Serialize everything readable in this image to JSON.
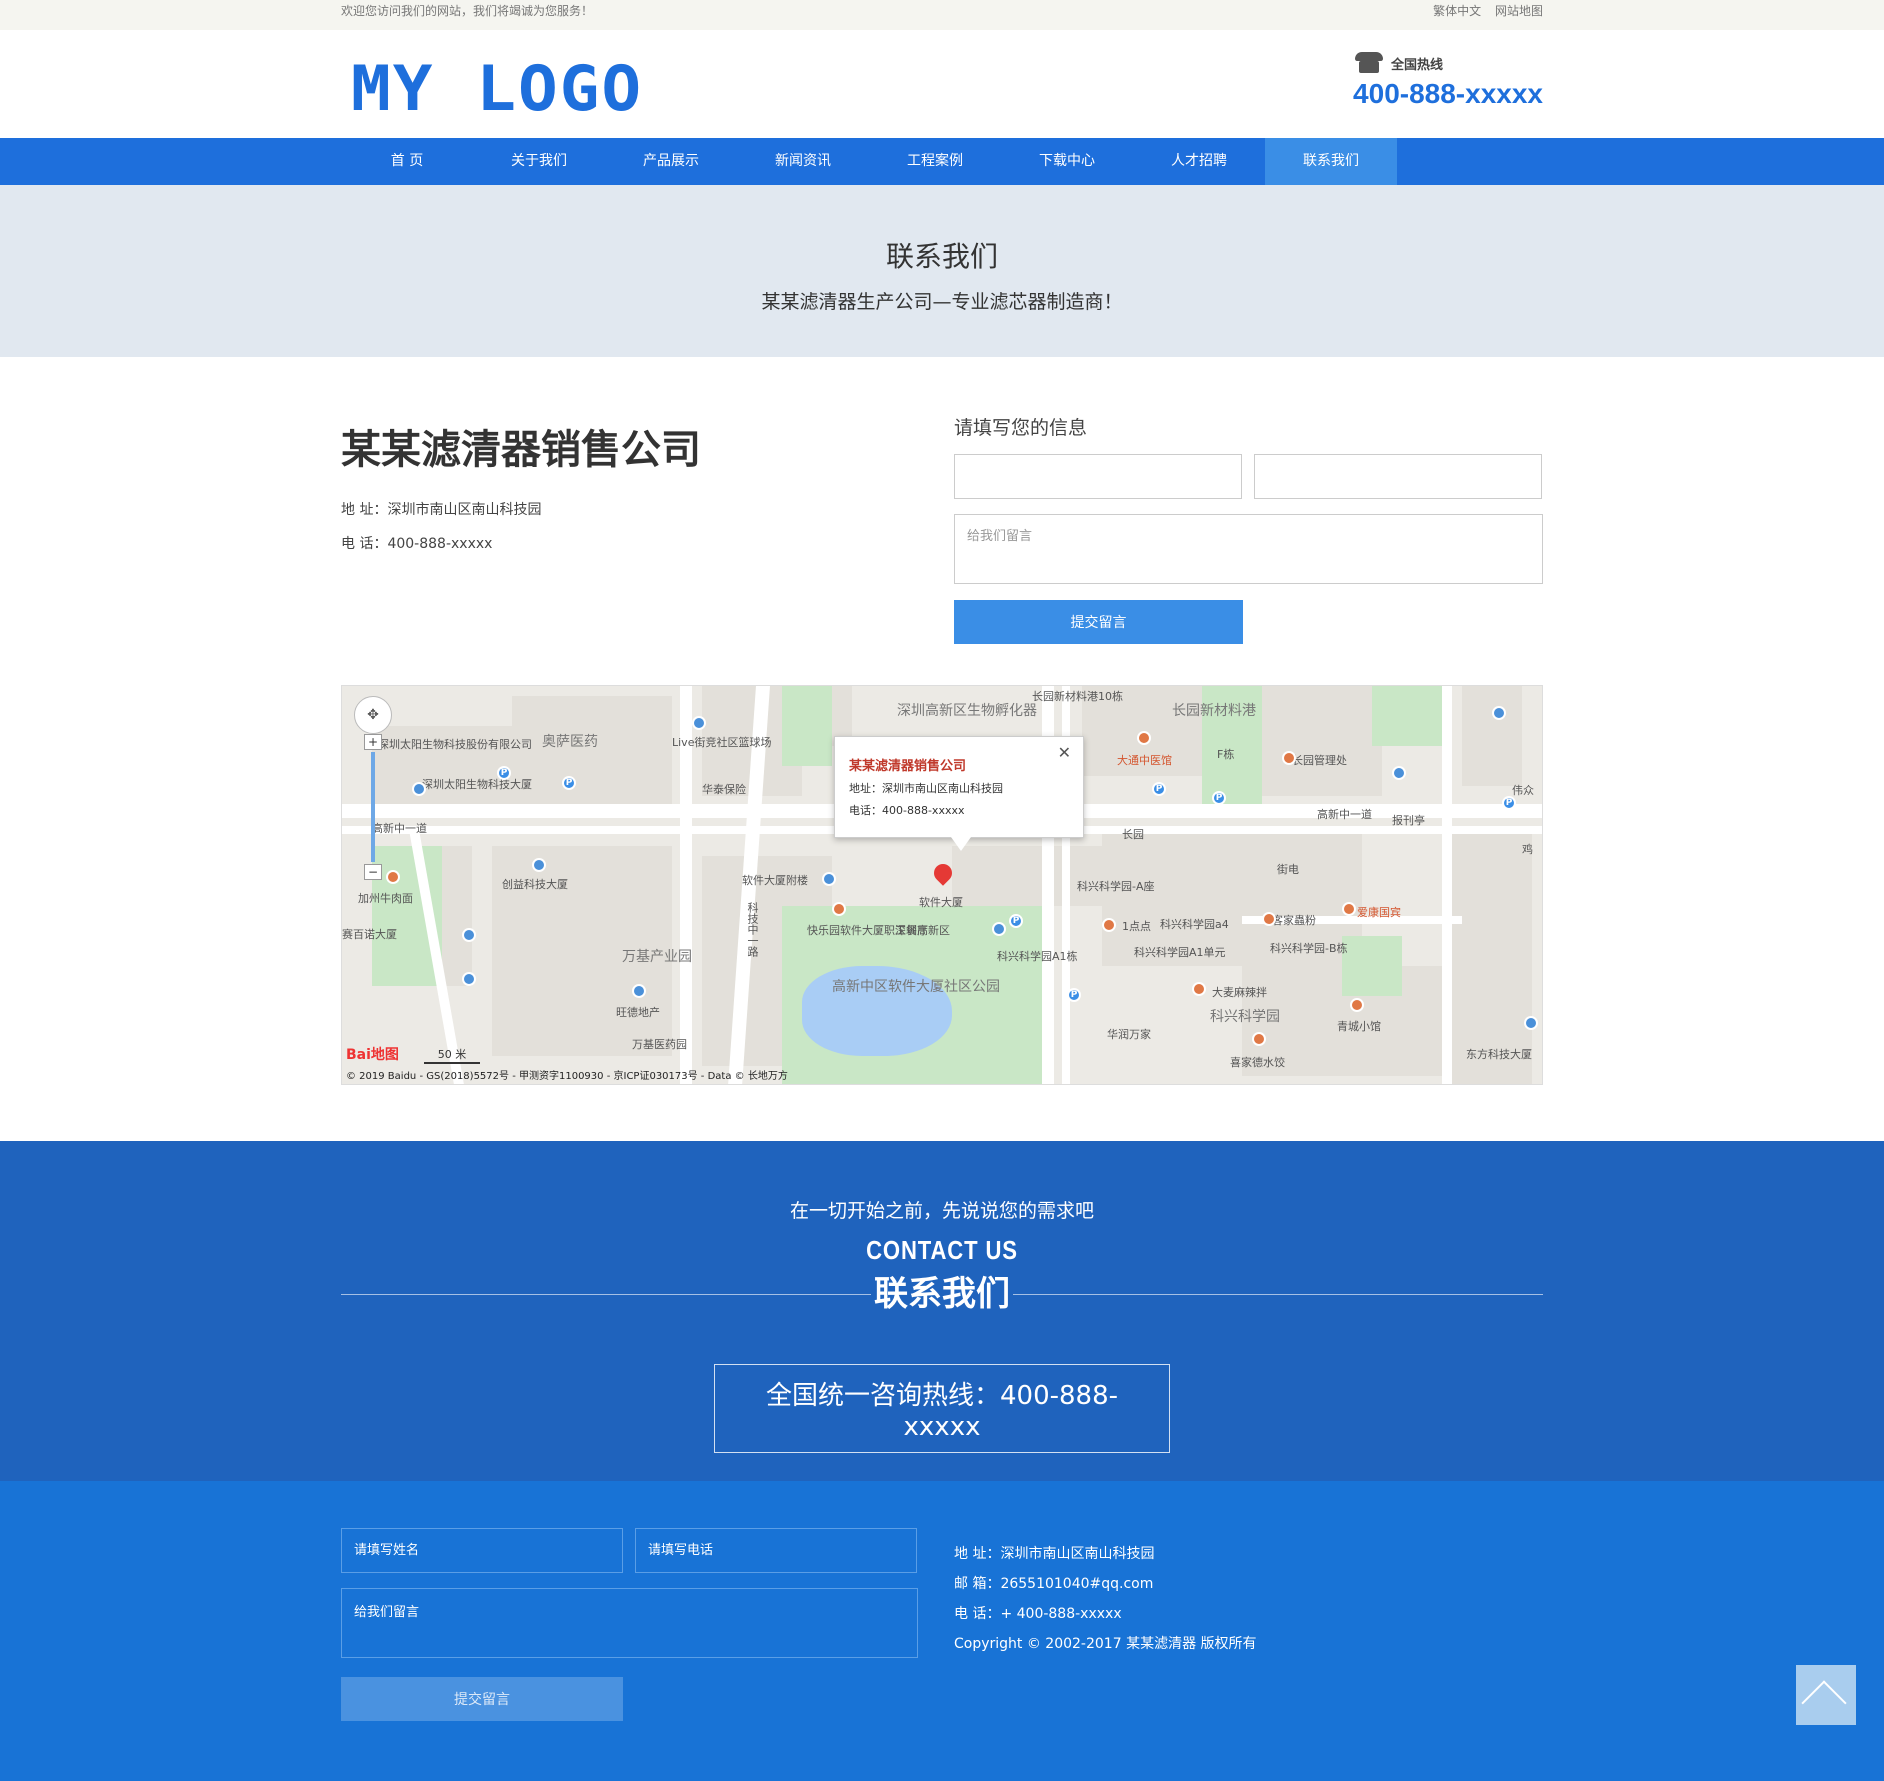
{
  "topbar": {
    "welcome": "欢迎您访问我们的网站，我们将竭诚为您服务！",
    "links": [
      "繁体中文",
      "网站地图"
    ]
  },
  "header": {
    "logo": "MY LOGO",
    "hotline_label": "全国热线",
    "hotline_number": "400-888-xxxxx"
  },
  "nav": {
    "items": [
      "首 页",
      "关于我们",
      "产品展示",
      "新闻资讯",
      "工程案例",
      "下载中心",
      "人才招聘",
      "联系我们"
    ],
    "active_index": 7
  },
  "banner": {
    "title": "联系我们",
    "subtitle": "某某滤清器生产公司—专业滤芯器制造商！"
  },
  "company": {
    "name": "某某滤清器销售公司",
    "address": "地 址：深圳市南山区南山科技园",
    "phone": "电 话：400-888-xxxxx"
  },
  "form1": {
    "title": "请填写您的信息",
    "message_placeholder": "给我们留言",
    "submit_label": "提交留言"
  },
  "map": {
    "popup_title": "某某滤清器销售公司",
    "popup_address": "地址：深圳市南山区南山科技园",
    "popup_phone": "电话：400-888-xxxxx",
    "close": "✕",
    "labels": [
      "深圳太阳生物科技股份有限公司",
      "奥萨医药",
      "Live街竞社区篮球场",
      "深圳高新区生物孵化器",
      "长园新材料港10栋",
      "长园新材料港",
      "大通中医馆",
      "F栋",
      "长园管理处",
      "伟众",
      "深圳太阳生物科技大厦",
      "华泰保险",
      "高新中一道",
      "长园",
      "高新中一道",
      "报刊亭",
      "鸡",
      "街电",
      "科兴科学园-A座",
      "创益科技大厦",
      "软件大厦附楼",
      "软件大厦",
      "加州牛肉面",
      "赛百诺大厦",
      "1点点",
      "科兴科学园a4",
      "客家蟲粉",
      "爱康国宾",
      "快乐园软件大厦职工餐厅",
      "深圳高新区",
      "科兴科学园A1栋",
      "科兴科学园A1单元",
      "科兴科学园-B栋",
      "万基产业园",
      "高新中区软件大厦社区公园",
      "大麦麻辣拌",
      "科兴科学园",
      "青城小馆",
      "旺德地产",
      "华润万家",
      "万基医药园",
      "喜家德水饺",
      "东方科技大厦",
      "科技中一路"
    ],
    "scale": "50 米",
    "logo_text": "Bai地图",
    "copyright": "© 2019 Baidu - GS(2018)5572号 - 甲测资字1100930 - 京ICP证030173号 - Data © 长地万方"
  },
  "cta": {
    "sub": "在一切开始之前，先说说您的需求吧",
    "en": "CONTACT US",
    "cn": "联系我们",
    "hotline": "全国统一咨询热线：400-888-xxxxx"
  },
  "footer": {
    "name_placeholder": "请填写姓名",
    "phone_placeholder": "请填写电话",
    "message_placeholder": "给我们留言",
    "submit_label": "提交留言",
    "address": "地 址：深圳市南山区南山科技园",
    "email": "邮 箱：2655101040#qq.com",
    "phone": "电 话：+ 400-888-xxxxx",
    "copyright": "Copyright © 2002-2017 某某滤清器 版权所有"
  },
  "colors": {
    "primary": "#1e6fdc",
    "nav_active": "#3a8ee6",
    "cta_bg": "#1f63bd",
    "footer_bg": "#1873d6",
    "banner_bg": "#e1e8f0"
  }
}
